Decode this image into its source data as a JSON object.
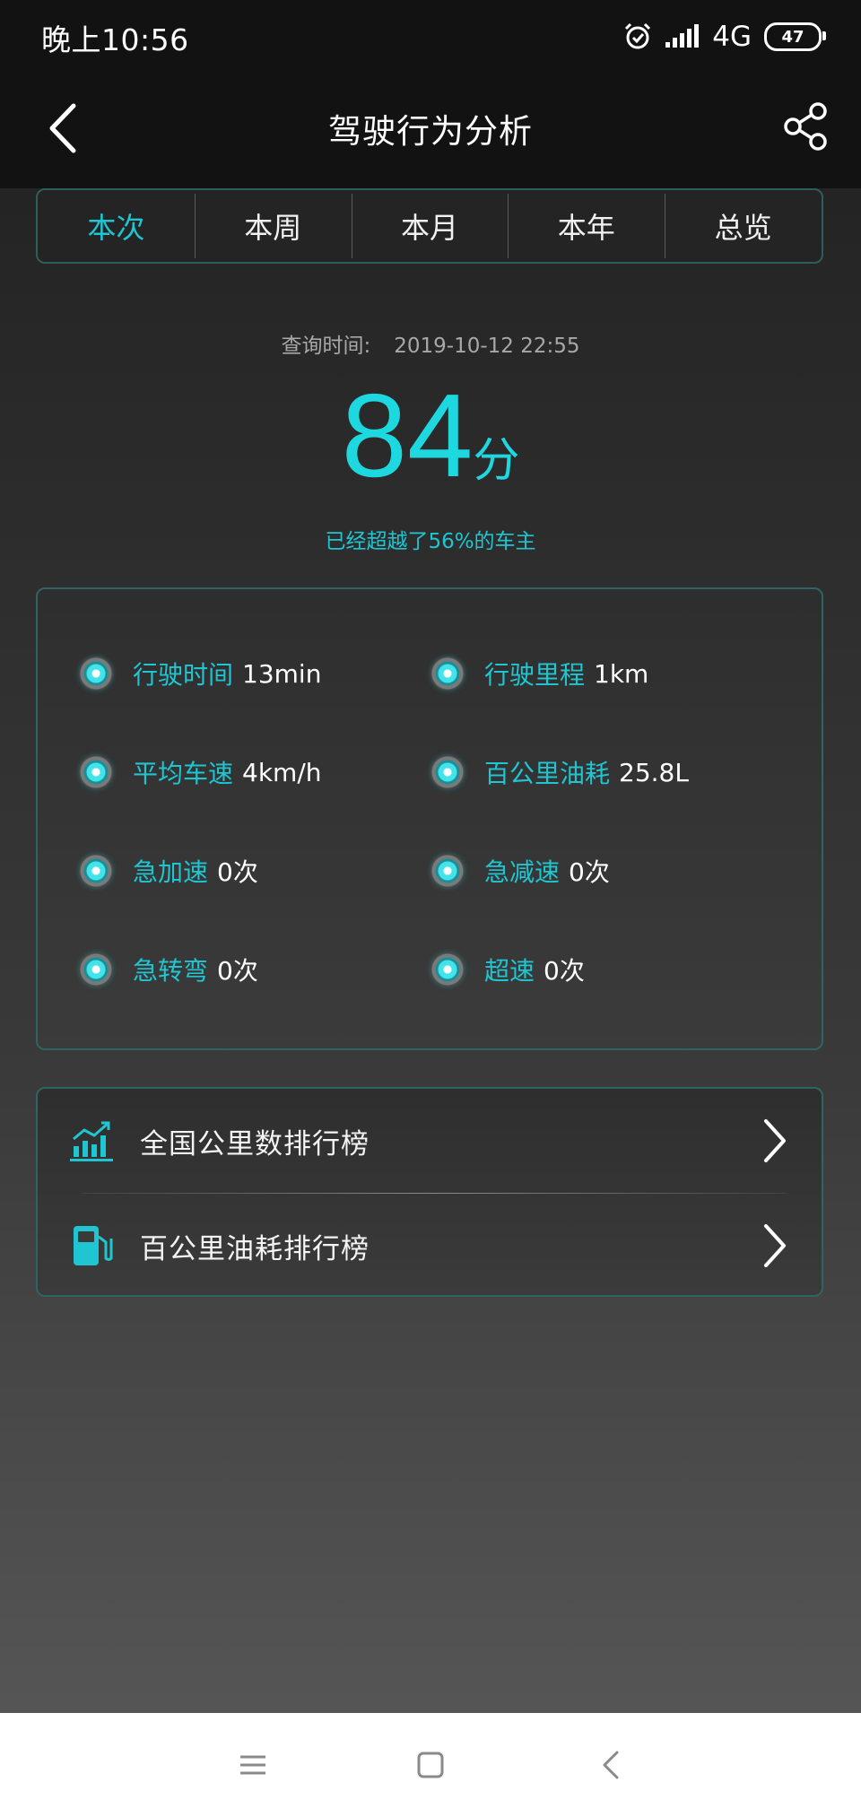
{
  "status_bar": {
    "time": "晚上10:56",
    "network": "4G",
    "battery": "47"
  },
  "header": {
    "title": "驾驶行为分析"
  },
  "tabs": [
    {
      "label": "本次",
      "active": true
    },
    {
      "label": "本周",
      "active": false
    },
    {
      "label": "本月",
      "active": false
    },
    {
      "label": "本年",
      "active": false
    },
    {
      "label": "总览",
      "active": false
    }
  ],
  "summary": {
    "query_label": "查询时间:",
    "query_value": "2019-10-12 22:55",
    "score": "84",
    "score_unit": "分",
    "surpass_text": "已经超越了56%的车主"
  },
  "stats": [
    {
      "label": "行驶时间",
      "value": "13min"
    },
    {
      "label": "行驶里程",
      "value": "1km"
    },
    {
      "label": "平均车速",
      "value": "4km/h"
    },
    {
      "label": "百公里油耗",
      "value": "25.8L"
    },
    {
      "label": "急加速",
      "value": "0次"
    },
    {
      "label": "急减速",
      "value": "0次"
    },
    {
      "label": "急转弯",
      "value": "0次"
    },
    {
      "label": "超速",
      "value": "0次"
    }
  ],
  "rankings": [
    {
      "label": "全国公里数排行榜",
      "icon": "bar-chart-icon"
    },
    {
      "label": "百公里油耗排行榜",
      "icon": "fuel-pump-icon"
    }
  ],
  "colors": {
    "accent": "#1fc6d2",
    "score": "#1ed8e0",
    "card_border": "#2e6564",
    "bar_background": "#121212"
  }
}
